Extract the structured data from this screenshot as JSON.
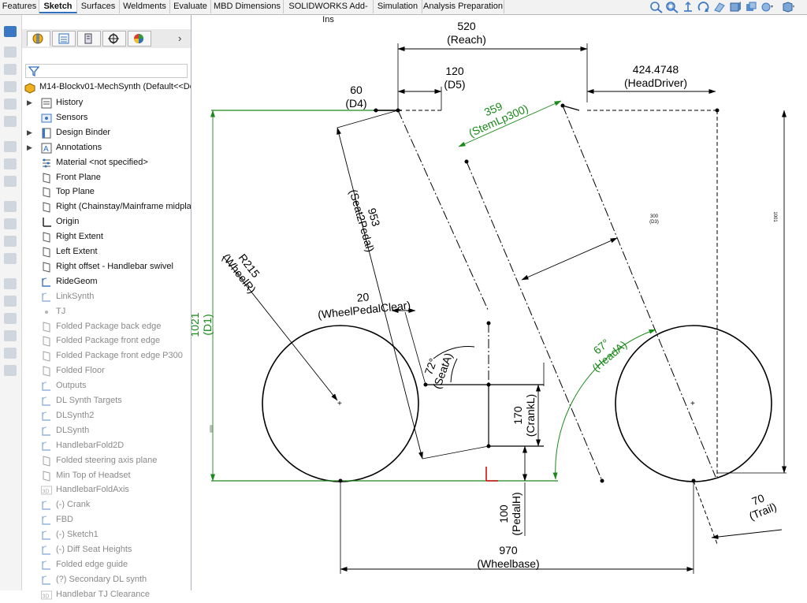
{
  "command_tabs": [
    "Features",
    "Sketch",
    "Surfaces",
    "Weldments",
    "Evaluate",
    "MBD Dimensions",
    "SOLIDWORKS Add-Ins",
    "Simulation",
    "Analysis Preparation"
  ],
  "active_tab": "Sketch",
  "heads_up_toolbar": [
    "zoom-to-fit-icon",
    "zoom-to-area-icon",
    "previous-view-icon",
    "section-view-icon",
    "view-orientation-icon",
    "display-style-icon",
    "hide-show-items-icon",
    "edit-appearance-icon",
    "apply-scene-icon",
    "view-settings-icon"
  ],
  "feature_manager": {
    "tabs": [
      "featuremanager-tab",
      "propertymanager-tab",
      "configurationmanager-tab",
      "dimxpertmanager-tab",
      "displaymanager-tab"
    ],
    "root_label": "M14-Blockv01-MechSynth  (Default<<Def",
    "items": [
      {
        "label": "History",
        "icon": "history-icon",
        "expandable": true,
        "dim": false
      },
      {
        "label": "Sensors",
        "icon": "sensors-icon",
        "expandable": false,
        "dim": false
      },
      {
        "label": "Design Binder",
        "icon": "design-binder-icon",
        "expandable": true,
        "dim": false
      },
      {
        "label": "Annotations",
        "icon": "annotations-icon",
        "expandable": true,
        "dim": false
      },
      {
        "label": "Material <not specified>",
        "icon": "material-icon",
        "expandable": false,
        "dim": false
      },
      {
        "label": "Front Plane",
        "icon": "plane-icon",
        "expandable": false,
        "dim": false
      },
      {
        "label": "Top Plane",
        "icon": "plane-icon",
        "expandable": false,
        "dim": false
      },
      {
        "label": "Right (Chainstay/Mainframe midplan",
        "icon": "plane-icon",
        "expandable": false,
        "dim": false
      },
      {
        "label": "Origin",
        "icon": "origin-icon",
        "expandable": false,
        "dim": false
      },
      {
        "label": "Right Extent",
        "icon": "plane-icon",
        "expandable": false,
        "dim": false
      },
      {
        "label": "Left Extent",
        "icon": "plane-icon",
        "expandable": false,
        "dim": false
      },
      {
        "label": "Right offset - Handlebar swivel",
        "icon": "plane-icon",
        "expandable": false,
        "dim": false
      },
      {
        "label": "RideGeom",
        "icon": "sketch-icon",
        "expandable": false,
        "dim": false
      },
      {
        "label": "LinkSynth",
        "icon": "sketch-icon",
        "expandable": false,
        "dim": true
      },
      {
        "label": "TJ",
        "icon": "point-icon",
        "expandable": false,
        "dim": true
      },
      {
        "label": "Folded Package back edge",
        "icon": "plane-icon",
        "expandable": false,
        "dim": true
      },
      {
        "label": "Folded Package front edge",
        "icon": "plane-icon",
        "expandable": false,
        "dim": true
      },
      {
        "label": "Folded Package front edge P300",
        "icon": "plane-icon",
        "expandable": false,
        "dim": true
      },
      {
        "label": "Folded Floor",
        "icon": "plane-icon",
        "expandable": false,
        "dim": true
      },
      {
        "label": "Outputs",
        "icon": "sketch-icon",
        "expandable": false,
        "dim": true
      },
      {
        "label": "DL Synth Targets",
        "icon": "sketch-icon",
        "expandable": false,
        "dim": true
      },
      {
        "label": "DLSynth2",
        "icon": "sketch-icon",
        "expandable": false,
        "dim": true
      },
      {
        "label": "DLSynth",
        "icon": "sketch-icon",
        "expandable": false,
        "dim": true
      },
      {
        "label": "HandlebarFold2D",
        "icon": "sketch-icon",
        "expandable": false,
        "dim": true
      },
      {
        "label": "Folded steering axis plane",
        "icon": "plane-icon",
        "expandable": false,
        "dim": true
      },
      {
        "label": "Min Top of Headset",
        "icon": "plane-icon",
        "expandable": false,
        "dim": true
      },
      {
        "label": "HandlebarFoldAxis",
        "icon": "sketch3d-icon",
        "expandable": false,
        "dim": true
      },
      {
        "label": "(-) Crank",
        "icon": "sketch-icon",
        "expandable": false,
        "dim": true
      },
      {
        "label": "FBD",
        "icon": "sketch-icon",
        "expandable": false,
        "dim": true
      },
      {
        "label": "(-) Sketch1",
        "icon": "sketch-icon",
        "expandable": false,
        "dim": true
      },
      {
        "label": "(-) Diff Seat Heights",
        "icon": "sketch-icon",
        "expandable": false,
        "dim": true
      },
      {
        "label": "Folded edge guide",
        "icon": "sketch-icon",
        "expandable": false,
        "dim": true
      },
      {
        "label": "(?) Secondary DL synth",
        "icon": "sketch-icon",
        "expandable": false,
        "dim": true
      },
      {
        "label": "Handlebar TJ Clearance",
        "icon": "sketch3d-icon",
        "expandable": false,
        "dim": true
      }
    ]
  },
  "dimensions": {
    "reach": {
      "value": "520",
      "name": "(Reach)"
    },
    "d5": {
      "value": "120",
      "name": "(D5)"
    },
    "d4": {
      "value": "60",
      "name": "(D4)"
    },
    "head_driver": {
      "value": "424.4748",
      "name": "(HeadDriver)"
    },
    "stem_lp300": {
      "value": "359",
      "name": "(StemLp300)"
    },
    "seat2pedal": {
      "value": "953",
      "name": "(Seat2Pedal)"
    },
    "wheel_r": {
      "value": "R215",
      "name": "(WheelR)"
    },
    "d1": {
      "value": "1021",
      "name": "(D1)"
    },
    "wheel_pedal_clear": {
      "value": "20",
      "name": "(WheelPedalClear)"
    },
    "seat_a": {
      "value": "72°",
      "name": "(SeatA)"
    },
    "crank_l": {
      "value": "170",
      "name": "(CrankL)"
    },
    "head_a": {
      "value": "67°",
      "name": "(HeadA)"
    },
    "pedal_h": {
      "value": "100",
      "name": "(PedalH)"
    },
    "trail": {
      "value": "70",
      "name": "(Trail)"
    },
    "wheelbase": {
      "value": "970",
      "name": "(Wheelbase)"
    },
    "small_300": {
      "value": "300",
      "name": "(D3)"
    },
    "small_1001": {
      "value": "1001"
    }
  },
  "colors": {
    "driven_dimension": "#1a8a1a",
    "sketch_line": "#000000",
    "origin_x": "#d01010",
    "active_tab_underline": "#2f6fbf"
  }
}
